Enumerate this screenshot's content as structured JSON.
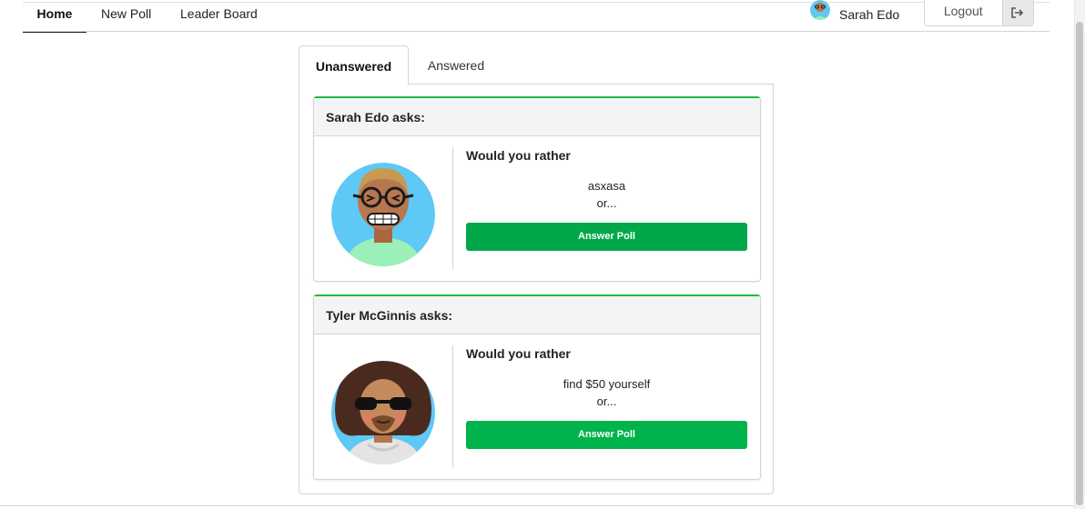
{
  "nav": {
    "home": "Home",
    "new_poll": "New Poll",
    "leader_board": "Leader Board",
    "user_name": "Sarah Edo",
    "logout": "Logout"
  },
  "tabs": {
    "unanswered": "Unanswered",
    "answered": "Answered"
  },
  "polls": [
    {
      "author_line": "Sarah Edo asks:",
      "question": "Would you rather",
      "option": "asxasa",
      "or": "or...",
      "button": "Answer Poll"
    },
    {
      "author_line": "Tyler McGinnis asks:",
      "question": "Would you rather",
      "option": "find $50 yourself",
      "or": "or...",
      "button": "Answer Poll"
    }
  ],
  "colors": {
    "card_accent": "#21ba45",
    "button_green": "#00b34a",
    "header_bg": "#f3f4f5"
  },
  "icons": {
    "logout": "sign-out-icon"
  }
}
